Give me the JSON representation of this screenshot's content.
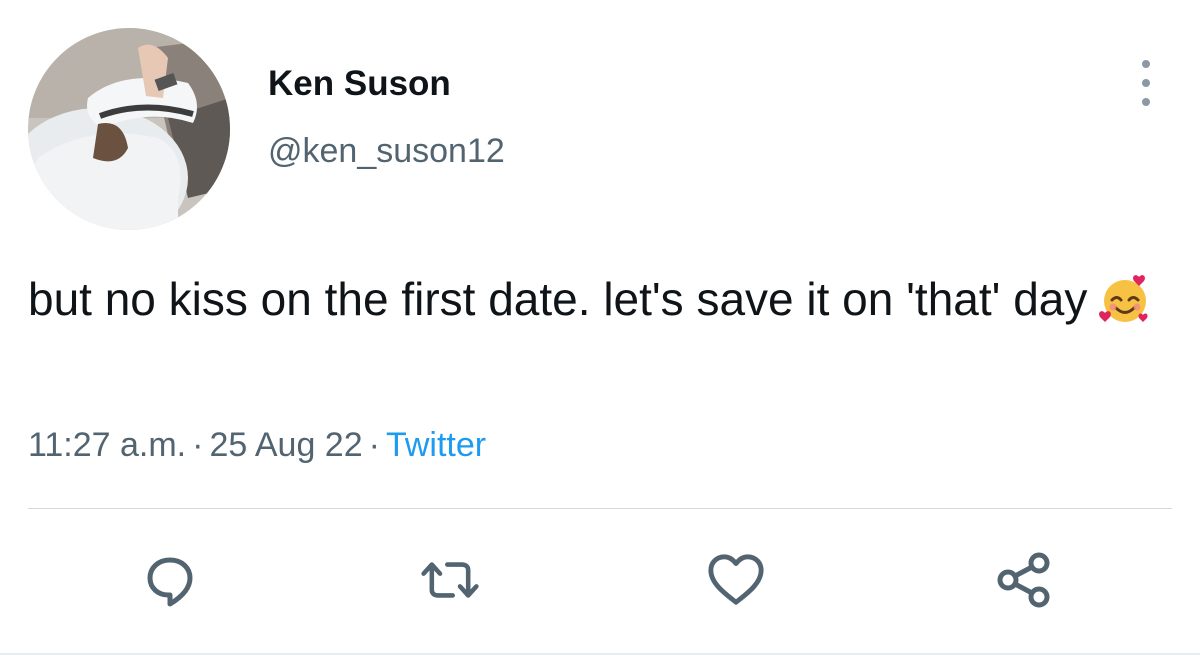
{
  "user": {
    "display_name": "Ken Suson",
    "handle": "@ken_suson12"
  },
  "tweet": {
    "text": "but no kiss on the first date. let's save it on 'that' day",
    "emoji": "smiling-face-with-hearts"
  },
  "meta": {
    "time": "11:27 a.m.",
    "date": "25 Aug 22",
    "separator": "·",
    "source": "Twitter"
  },
  "actions": {
    "reply_icon": "reply-icon",
    "retweet_icon": "retweet-icon",
    "like_icon": "heart-icon",
    "share_icon": "share-icon"
  },
  "colors": {
    "text_primary": "#0f1419",
    "text_secondary": "#536471",
    "link": "#1d9bf0",
    "icon": "#536471",
    "divider": "#cfd9de"
  }
}
